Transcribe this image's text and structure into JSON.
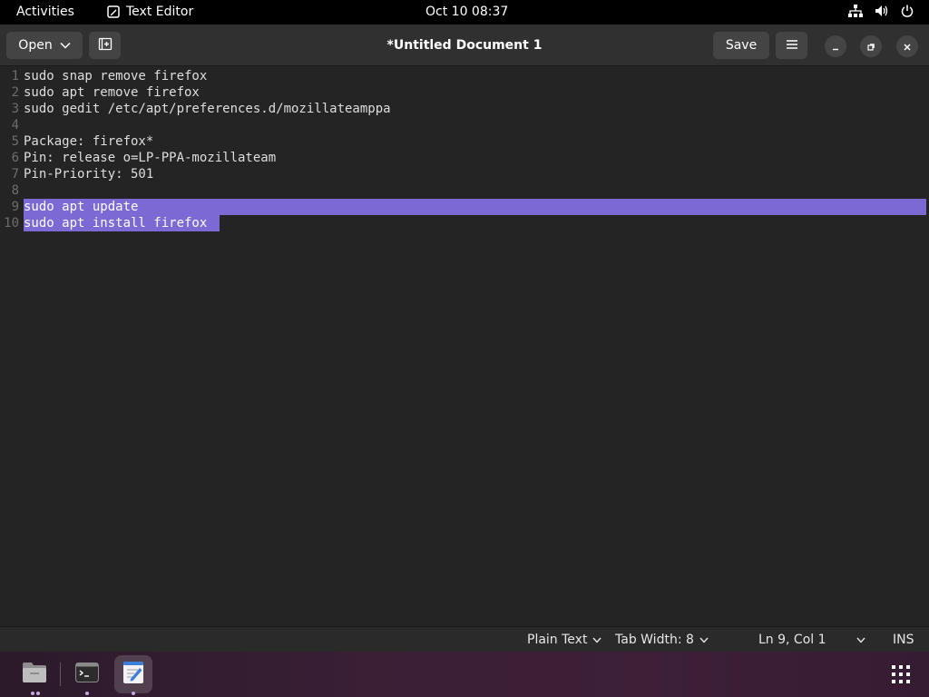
{
  "topbar": {
    "activities": "Activities",
    "app_name": "Text Editor",
    "clock": "Oct 10  08:37",
    "icons": [
      "network-icon",
      "volume-icon",
      "power-icon"
    ]
  },
  "header": {
    "open_label": "Open",
    "title": "*Untitled Document 1",
    "save_label": "Save",
    "icons": [
      "chevron-down-icon",
      "new-tab-icon",
      "hamburger-menu-icon",
      "minimize-icon",
      "maximize-icon",
      "close-icon"
    ]
  },
  "editor": {
    "lines": [
      {
        "num": "1",
        "text": "sudo snap remove firefox"
      },
      {
        "num": "2",
        "text": "sudo apt remove firefox"
      },
      {
        "num": "3",
        "text": "sudo gedit /etc/apt/preferences.d/mozillateamppa"
      },
      {
        "num": "4",
        "text": ""
      },
      {
        "num": "5",
        "text": "Package: firefox*"
      },
      {
        "num": "6",
        "text": "Pin: release o=LP-PPA-mozillateam"
      },
      {
        "num": "7",
        "text": "Pin-Priority: 501"
      },
      {
        "num": "8",
        "text": ""
      },
      {
        "num": "9",
        "text": "sudo apt update"
      },
      {
        "num": "10",
        "text": "sudo apt install firefox"
      }
    ],
    "selection_color": "#7d69d4"
  },
  "statusbar": {
    "language": "Plain Text",
    "tab_width": "Tab Width: 8",
    "position": "Ln 9, Col 1",
    "mode": "INS"
  },
  "dock": {
    "apps": [
      "files-icon",
      "terminal-icon",
      "text-editor-icon"
    ],
    "show_apps": "app-grid-icon"
  }
}
